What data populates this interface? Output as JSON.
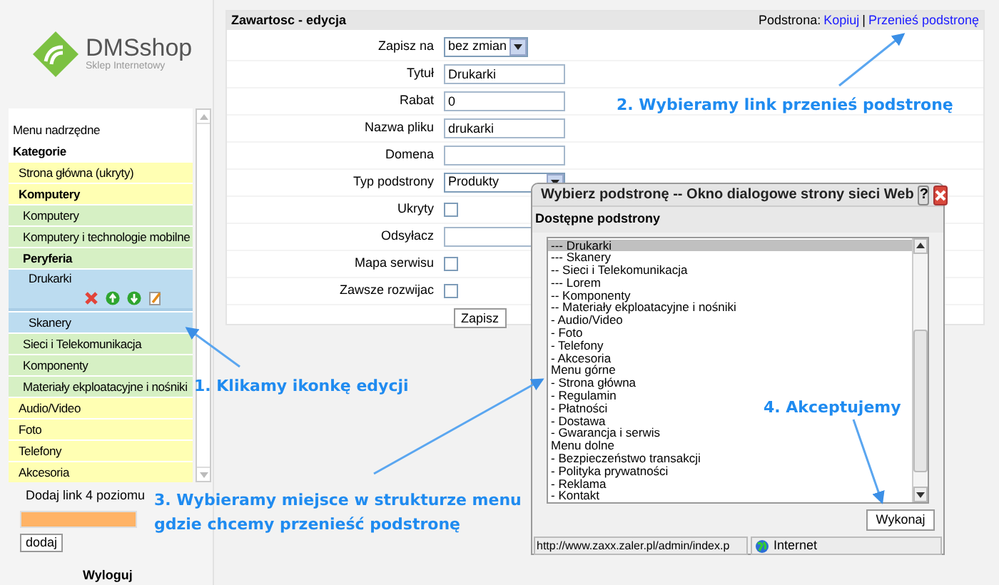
{
  "logo": {
    "name": "DMSshop",
    "tagline": "Sklep Internetowy"
  },
  "menu": {
    "items": [
      {
        "label": "Menu nadrzędne",
        "selected": false
      },
      {
        "label": "Kategorie",
        "selected": false,
        "children": [
          {
            "label": "Strona główna (ukryty)",
            "selected": false
          },
          {
            "label": "Komputery",
            "selected": false,
            "children": [
              {
                "label": "Komputery",
                "selected": false
              },
              {
                "label": "Komputery i technologie mobilne",
                "selected": false
              },
              {
                "label": "Peryferia",
                "selected": false,
                "children": [
                  {
                    "label": "Drukarki",
                    "selected": true
                  },
                  {
                    "label": "Skanery",
                    "selected": false
                  }
                ]
              },
              {
                "label": "Sieci i Telekomunikacja",
                "selected": false
              },
              {
                "label": "Komponenty",
                "selected": false
              },
              {
                "label": "Materiały ekploatacyjne i nośniki",
                "selected": false
              }
            ]
          },
          {
            "label": "Audio/Video",
            "selected": false
          },
          {
            "label": "Foto",
            "selected": false
          },
          {
            "label": "Telefony",
            "selected": false
          },
          {
            "label": "Akcesoria",
            "selected": false
          }
        ]
      }
    ]
  },
  "add_link": {
    "label": "Dodaj link 4 poziomu",
    "button": "dodaj"
  },
  "logout": "Wyloguj",
  "panel": {
    "title": "Zawartosc - edycja",
    "links_label": "Podstrona:",
    "links": [
      "Kopiuj",
      "Przenieś podstronę"
    ],
    "separator": "|",
    "fields": [
      {
        "label": "Zapisz na",
        "kind": "select",
        "value": "bez zmian"
      },
      {
        "label": "Tytuł",
        "kind": "text",
        "value": "Drukarki"
      },
      {
        "label": "Rabat",
        "kind": "text",
        "value": "0"
      },
      {
        "label": "Nazwa pliku",
        "kind": "text",
        "value": "drukarki"
      },
      {
        "label": "Domena",
        "kind": "text"
      },
      {
        "label": "Typ podstrony",
        "kind": "select",
        "value": "Produkty"
      },
      {
        "label": "Ukryty",
        "kind": "checkbox",
        "checked": false
      },
      {
        "label": "Odsyłacz",
        "kind": "text"
      },
      {
        "label": "Mapa serwisu",
        "kind": "checkbox",
        "checked": false
      },
      {
        "label": "Zawsze rozwijac",
        "kind": "checkbox",
        "checked": false
      }
    ],
    "submit": "Zapisz"
  },
  "dialog": {
    "title": "Wybierz podstronę -- Okno dialogowe strony sieci Web",
    "help": "?",
    "heading": "Dostępne podstrony",
    "options": [
      {
        "label": "--- Drukarki",
        "selected": true
      },
      {
        "label": "--- Skanery",
        "selected": false
      },
      {
        "label": "-- Sieci i Telekomunikacja",
        "selected": false
      },
      {
        "label": "--- Lorem",
        "selected": false
      },
      {
        "label": "-- Komponenty",
        "selected": false
      },
      {
        "label": "-- Materiały ekploatacyjne i nośniki",
        "selected": false
      },
      {
        "label": "- Audio/Video",
        "selected": false
      },
      {
        "label": "- Foto",
        "selected": false
      },
      {
        "label": "- Telefony",
        "selected": false
      },
      {
        "label": "- Akcesoria",
        "selected": false
      },
      {
        "label": "Menu górne",
        "selected": false
      },
      {
        "label": "- Strona główna",
        "selected": false
      },
      {
        "label": "- Regulamin",
        "selected": false
      },
      {
        "label": "- Płatności",
        "selected": false
      },
      {
        "label": "- Dostawa",
        "selected": false
      },
      {
        "label": "- Gwarancja i serwis",
        "selected": false
      },
      {
        "label": "Menu dolne",
        "selected": false
      },
      {
        "label": "- Bezpieczeństwo transakcji",
        "selected": false
      },
      {
        "label": "- Polityka prywatności",
        "selected": false
      },
      {
        "label": "- Reklama",
        "selected": false
      },
      {
        "label": "- Kontakt",
        "selected": false
      }
    ],
    "button": "Wykonaj",
    "status_url": "http://www.zaxx.zaler.pl/admin/index.p",
    "zone": "Internet"
  },
  "annotations": [
    {
      "lines": [
        "1. Klikamy ikonkę edycji"
      ]
    },
    {
      "lines": [
        "2. Wybieramy link przenieś podstronę"
      ]
    },
    {
      "lines": [
        "3. Wybieramy miejsce w strukturze menu",
        "gdzie chcemy przenieść podstronę"
      ]
    },
    {
      "lines": [
        "4. Akceptujemy"
      ]
    }
  ]
}
